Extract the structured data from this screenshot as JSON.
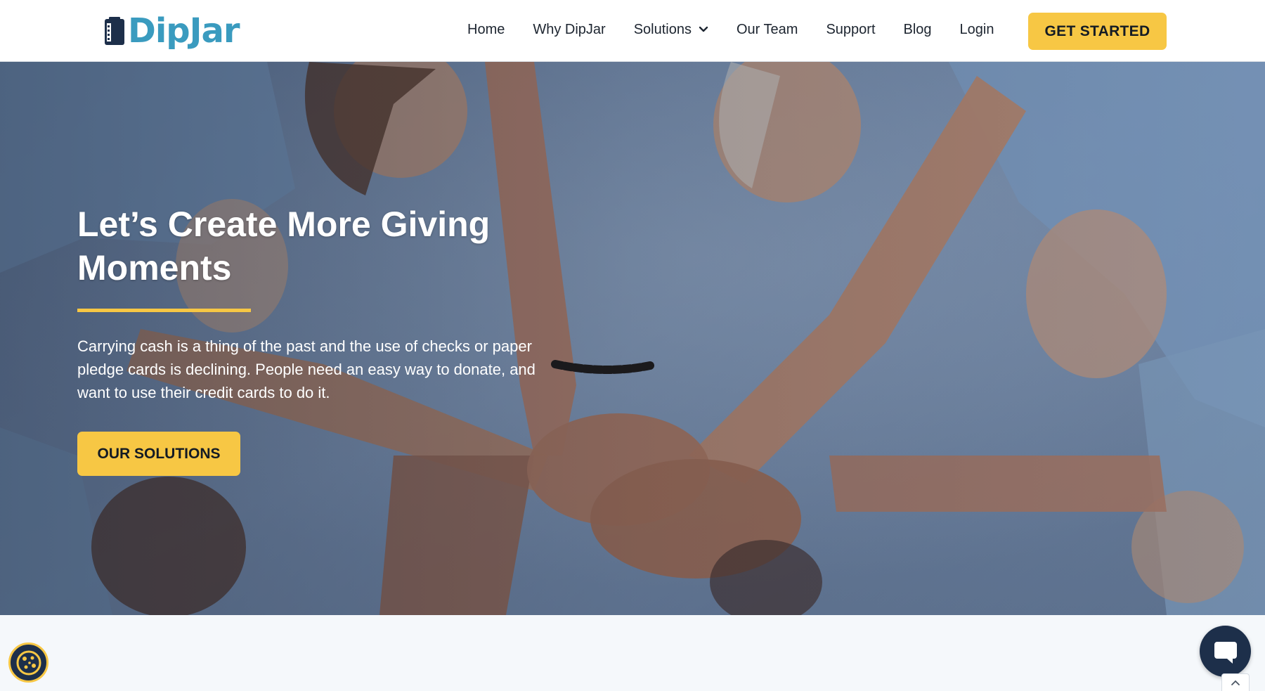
{
  "brand": {
    "name": "DipJar",
    "accent": "#3a9bbf",
    "cta_color": "#f7c744",
    "dark": "#1d2f4a"
  },
  "nav": {
    "items": [
      {
        "label": "Home"
      },
      {
        "label": "Why DipJar"
      },
      {
        "label": "Solutions",
        "has_dropdown": true
      },
      {
        "label": "Our Team"
      },
      {
        "label": "Support"
      },
      {
        "label": "Blog"
      },
      {
        "label": "Login"
      }
    ],
    "cta_label": "GET STARTED"
  },
  "hero": {
    "title": "Let’s Create More Giving Moments",
    "description": "Carrying cash is a thing of the past and the use of checks or paper pledge cards is declining. People need an easy way to donate, and want to use their credit cards to do it.",
    "cta_label": "OUR SOLUTIONS"
  },
  "widgets": {
    "cookie_icon": "cookie-icon",
    "chat_icon": "chat-bubble-icon",
    "scroll_icon": "chevron-up-icon"
  }
}
